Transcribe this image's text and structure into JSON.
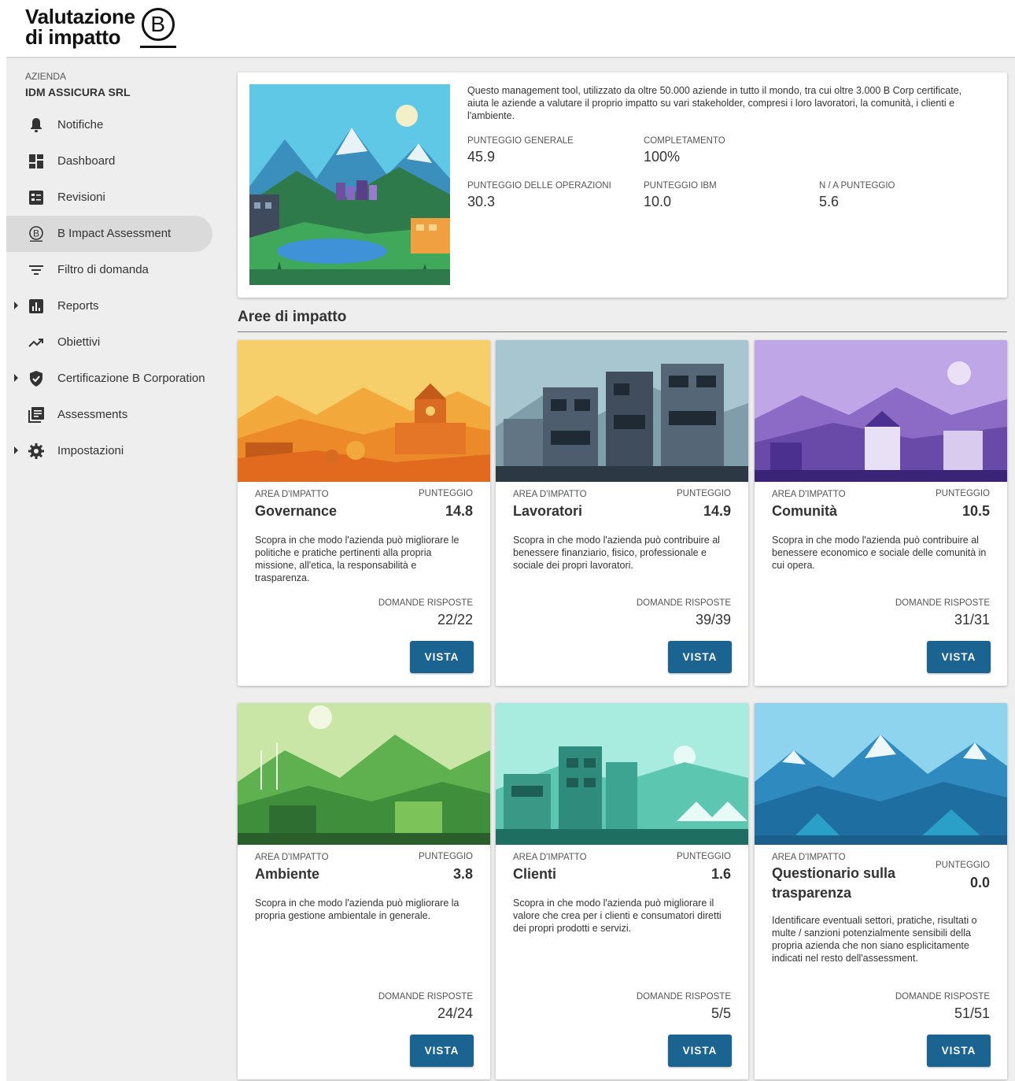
{
  "header": {
    "logo_line1": "Valutazione",
    "logo_line2": "di impatto",
    "logo_mark": "B"
  },
  "sidebar": {
    "company_label": "AZIENDA",
    "company_name": "IDM ASSICURA SRL",
    "items": [
      {
        "label": "Notifiche",
        "icon": "bell-icon",
        "expandable": false,
        "active": false
      },
      {
        "label": "Dashboard",
        "icon": "dashboard-icon",
        "expandable": false,
        "active": false
      },
      {
        "label": "Revisioni",
        "icon": "review-icon",
        "expandable": false,
        "active": false
      },
      {
        "label": "B Impact Assessment",
        "icon": "b-circle-icon",
        "expandable": false,
        "active": true
      },
      {
        "label": "Filtro di domanda",
        "icon": "filter-icon",
        "expandable": false,
        "active": false
      },
      {
        "label": "Reports",
        "icon": "bar-chart-icon",
        "expandable": true,
        "active": false
      },
      {
        "label": "Obiettivi",
        "icon": "trending-up-icon",
        "expandable": false,
        "active": false
      },
      {
        "label": "Certificazione B Corporation",
        "icon": "shield-check-icon",
        "expandable": true,
        "active": false
      },
      {
        "label": "Assessments",
        "icon": "library-books-icon",
        "expandable": false,
        "active": false
      },
      {
        "label": "Impostazioni",
        "icon": "gear-icon",
        "expandable": true,
        "active": false
      }
    ]
  },
  "intro": {
    "description": "Questo management tool, utilizzato da oltre 50.000 aziende in tutto il mondo, tra cui oltre 3.000 B Corp certificate, aiuta le aziende a valutare il proprio impatto su vari stakeholder, compresi i loro lavoratori, la comunità, i clienti e l'ambiente.",
    "stats": {
      "overall_label": "PUNTEGGIO GENERALE",
      "overall_value": "45.9",
      "completion_label": "COMPLETAMENTO",
      "completion_value": "100%",
      "operations_label": "PUNTEGGIO DELLE OPERAZIONI",
      "operations_value": "30.3",
      "ibm_label": "PUNTEGGIO IBM",
      "ibm_value": "10.0",
      "na_label": "N / A PUNTEGGIO",
      "na_value": "5.6"
    }
  },
  "section_title": "Aree di impatto",
  "cards": [
    {
      "area_label": "AREA D'IMPATTO",
      "name": "Governance",
      "score_label": "PUNTEGGIO",
      "score": "14.8",
      "description": "Scopra in che modo l'azienda può migliorare le politiche e pratiche pertinenti alla propria missione, all'etica, la responsabilità e trasparenza.",
      "answered_label": "DOMANDE RISPOSTE",
      "answered": "22/22",
      "button": "VISTA"
    },
    {
      "area_label": "AREA D'IMPATTO",
      "name": "Lavoratori",
      "score_label": "PUNTEGGIO",
      "score": "14.9",
      "description": "Scopra in che modo l'azienda può contribuire al benessere finanziario, fisico, professionale e sociale dei propri lavoratori.",
      "answered_label": "DOMANDE RISPOSTE",
      "answered": "39/39",
      "button": "VISTA"
    },
    {
      "area_label": "AREA D'IMPATTO",
      "name": "Comunità",
      "score_label": "PUNTEGGIO",
      "score": "10.5",
      "description": "Scopra in che modo l'azienda può contribuire al benessere economico e sociale delle comunità in cui opera.",
      "answered_label": "DOMANDE RISPOSTE",
      "answered": "31/31",
      "button": "VISTA"
    },
    {
      "area_label": "AREA D'IMPATTO",
      "name": "Ambiente",
      "score_label": "PUNTEGGIO",
      "score": "3.8",
      "description": "Scopra in che modo l'azienda può migliorare la propria gestione ambientale in generale.",
      "answered_label": "DOMANDE RISPOSTE",
      "answered": "24/24",
      "button": "VISTA"
    },
    {
      "area_label": "AREA D'IMPATTO",
      "name": "Clienti",
      "score_label": "PUNTEGGIO",
      "score": "1.6",
      "description": "Scopra in che modo l'azienda può migliorare il valore che crea per i clienti e consumatori diretti dei propri prodotti e servizi.",
      "answered_label": "DOMANDE RISPOSTE",
      "answered": "5/5",
      "button": "VISTA"
    },
    {
      "area_label": "AREA D'IMPATTO",
      "name": "Questionario sulla trasparenza",
      "score_label": "PUNTEGGIO",
      "score": "0.0",
      "description": "Identificare eventuali settori, pratiche, risultati o multe / sanzioni potenzialmente sensibili della propria azienda che non siano esplicitamente indicati nel resto dell'assessment.",
      "answered_label": "DOMANDE RISPOSTE",
      "answered": "51/51",
      "button": "VISTA"
    }
  ],
  "colors": {
    "button": "#1b6391",
    "sidebar_bg": "#eeeeee",
    "active_item_bg": "#dadada"
  }
}
